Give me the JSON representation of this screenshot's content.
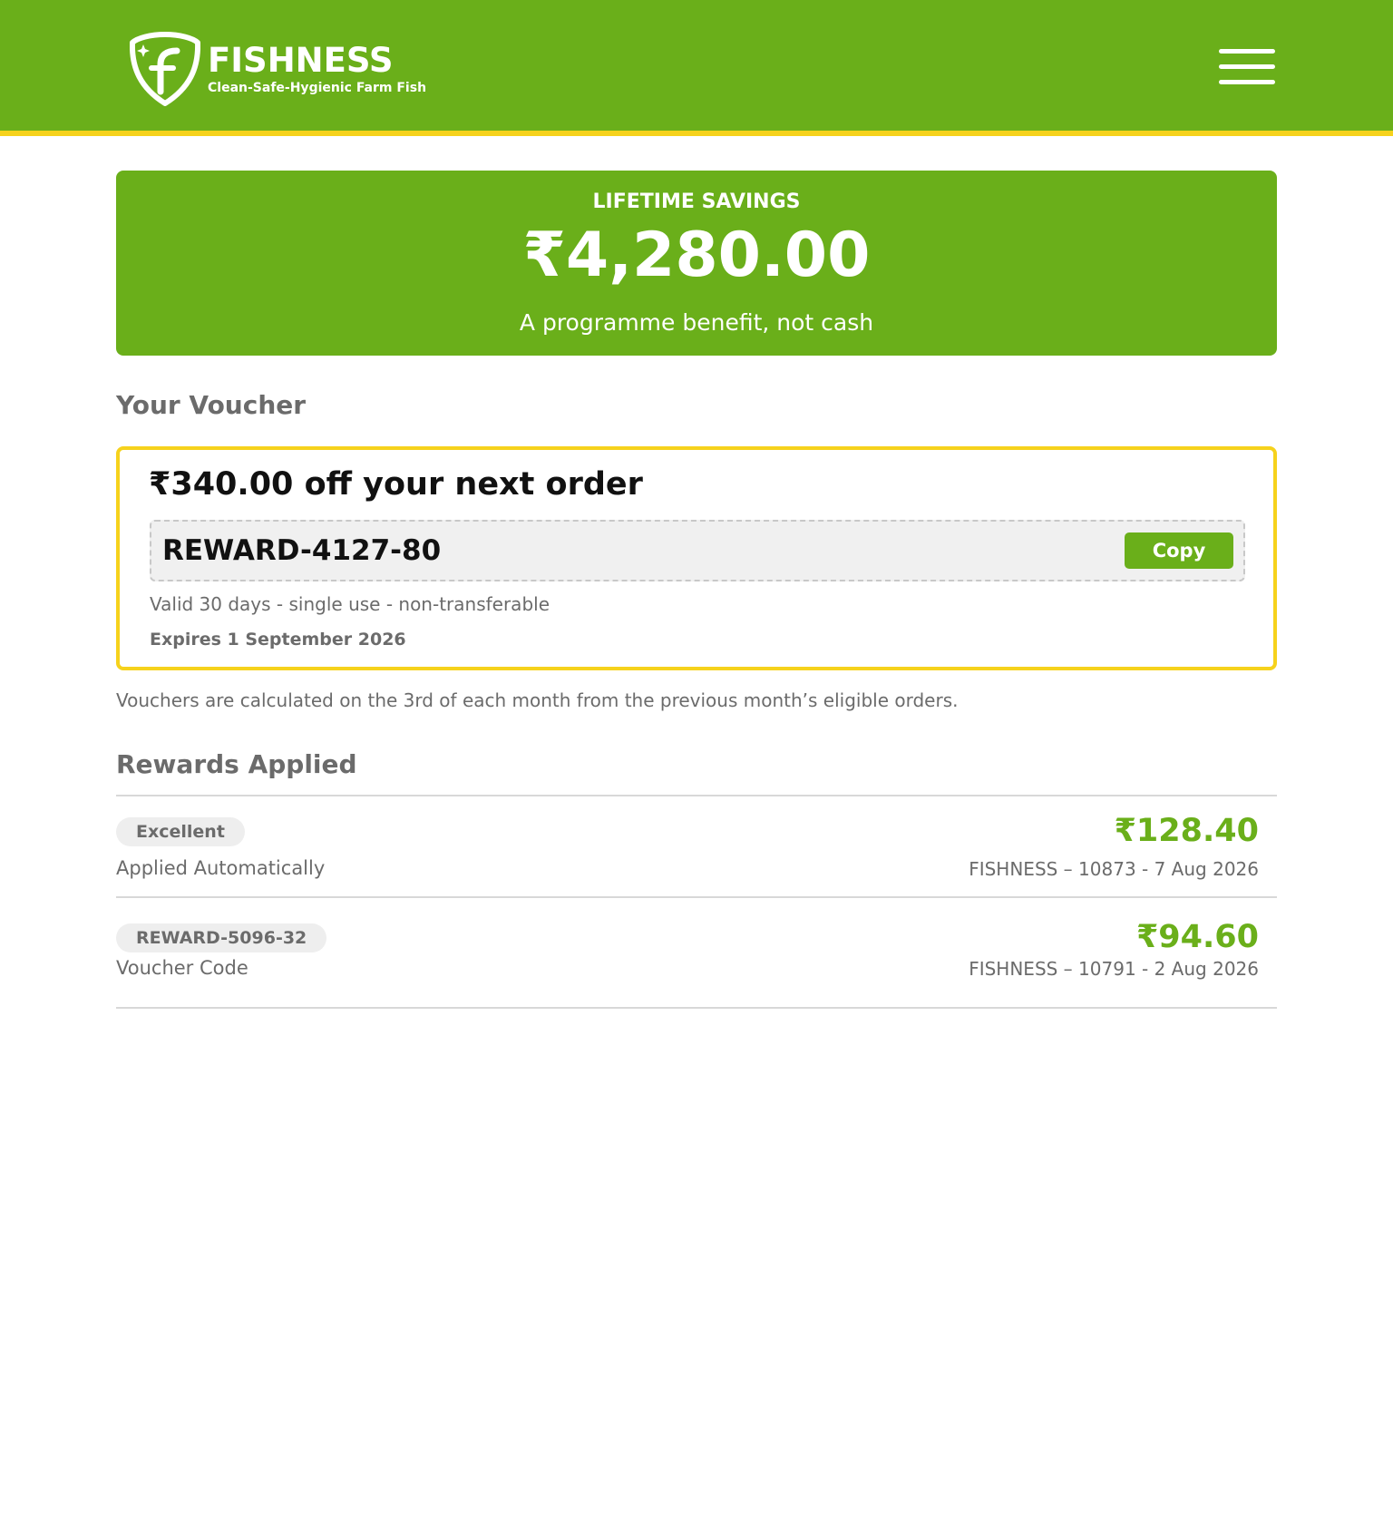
{
  "header": {
    "brand": "FISHNESS",
    "tagline": "Clean-Safe-Hygienic Farm Fish",
    "logo_letter": "F",
    "menu_icon": "hamburger-menu-icon"
  },
  "savings": {
    "label": "LIFETIME SAVINGS",
    "amount": "₹4,280.00",
    "subtitle": "A programme benefit, not cash"
  },
  "voucher": {
    "section_title": "Your Voucher",
    "title": "₹340.00 off your next order",
    "code": "REWARD-4127-80",
    "copy_label": "Copy",
    "validity": "Valid 30 days - single use - non-transferable",
    "expires": "Expires 1 September 2026"
  },
  "note": "Vouchers are calculated on the 3rd of each month from the previous month’s eligible orders.",
  "rewards": {
    "section_title": "Rewards Applied",
    "items": [
      {
        "pill": "Excellent",
        "type": "Applied Automatically",
        "amount": "₹128.40",
        "meta": "FISHNESS – 10873 - 7 Aug 2026"
      },
      {
        "pill": "REWARD-5096-32",
        "type": "Voucher Code",
        "amount": "₹94.60",
        "meta": "FISHNESS – 10791 - 2 Aug 2026"
      }
    ]
  },
  "colors": {
    "brand_green": "#6aaf1a",
    "accent_yellow": "#f6d21c",
    "text_gray": "#6b6b6b"
  }
}
